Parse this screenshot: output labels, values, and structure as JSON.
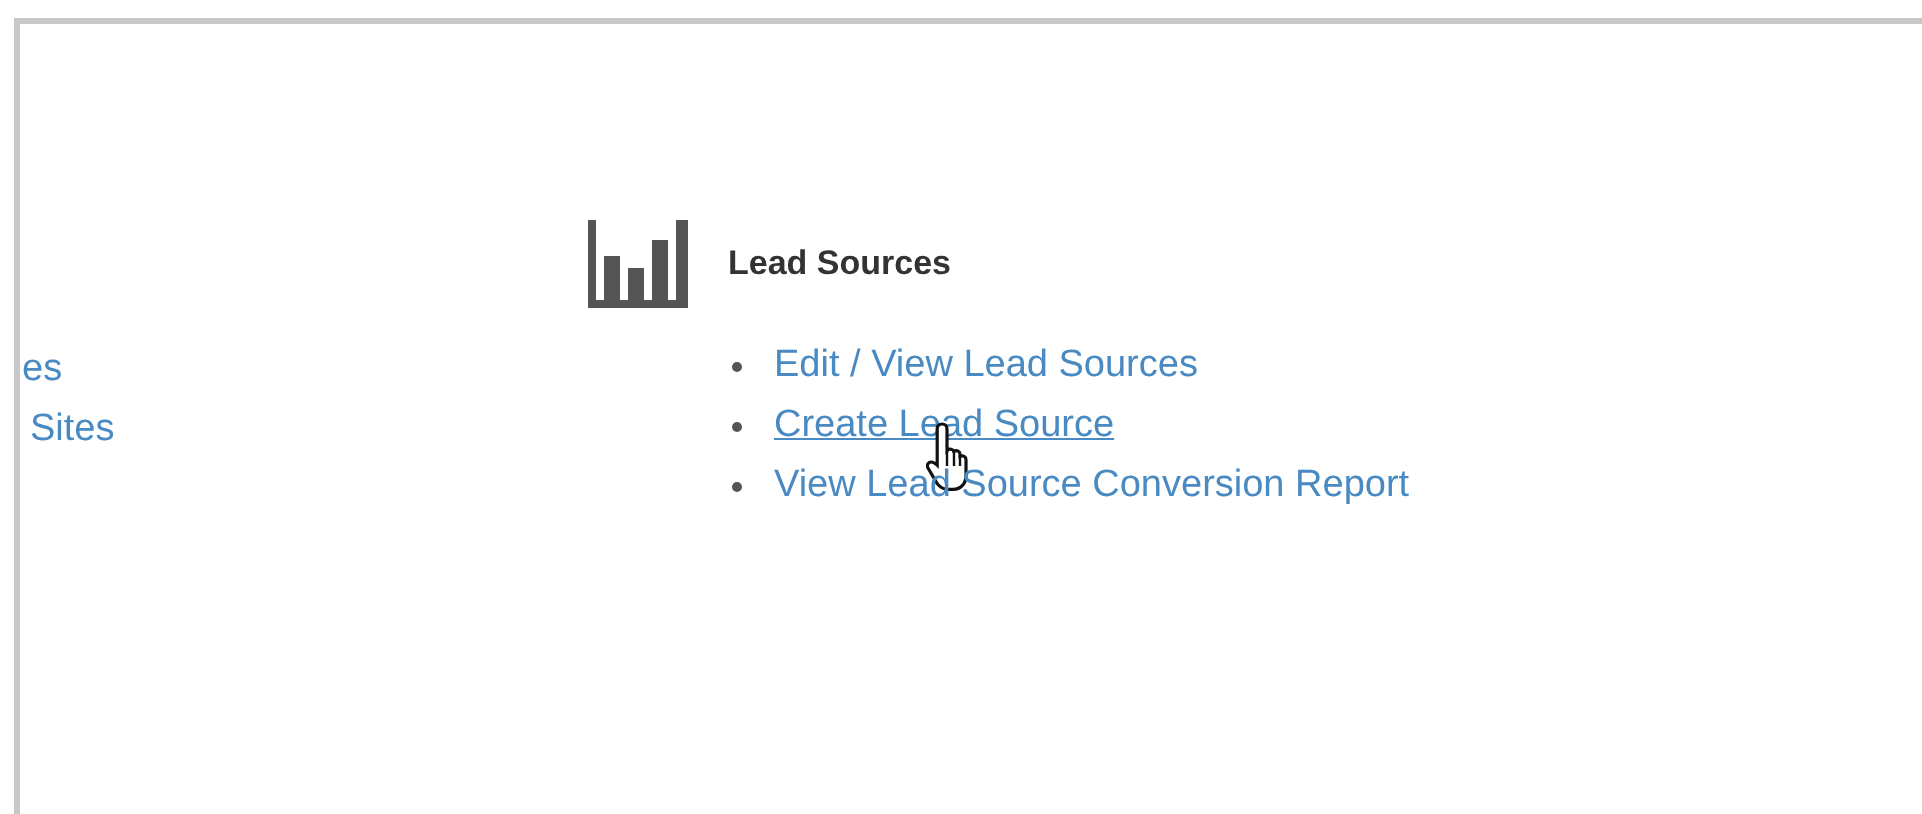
{
  "left_links": [
    {
      "label": "es"
    },
    {
      "label": "Sites"
    }
  ],
  "section": {
    "title": "Lead Sources",
    "links": [
      {
        "label": "Edit / View Lead Sources",
        "hovered": false
      },
      {
        "label": "Create Lead Source",
        "hovered": true
      },
      {
        "label": "View Lead Source Conversion Report",
        "hovered": false
      }
    ]
  }
}
